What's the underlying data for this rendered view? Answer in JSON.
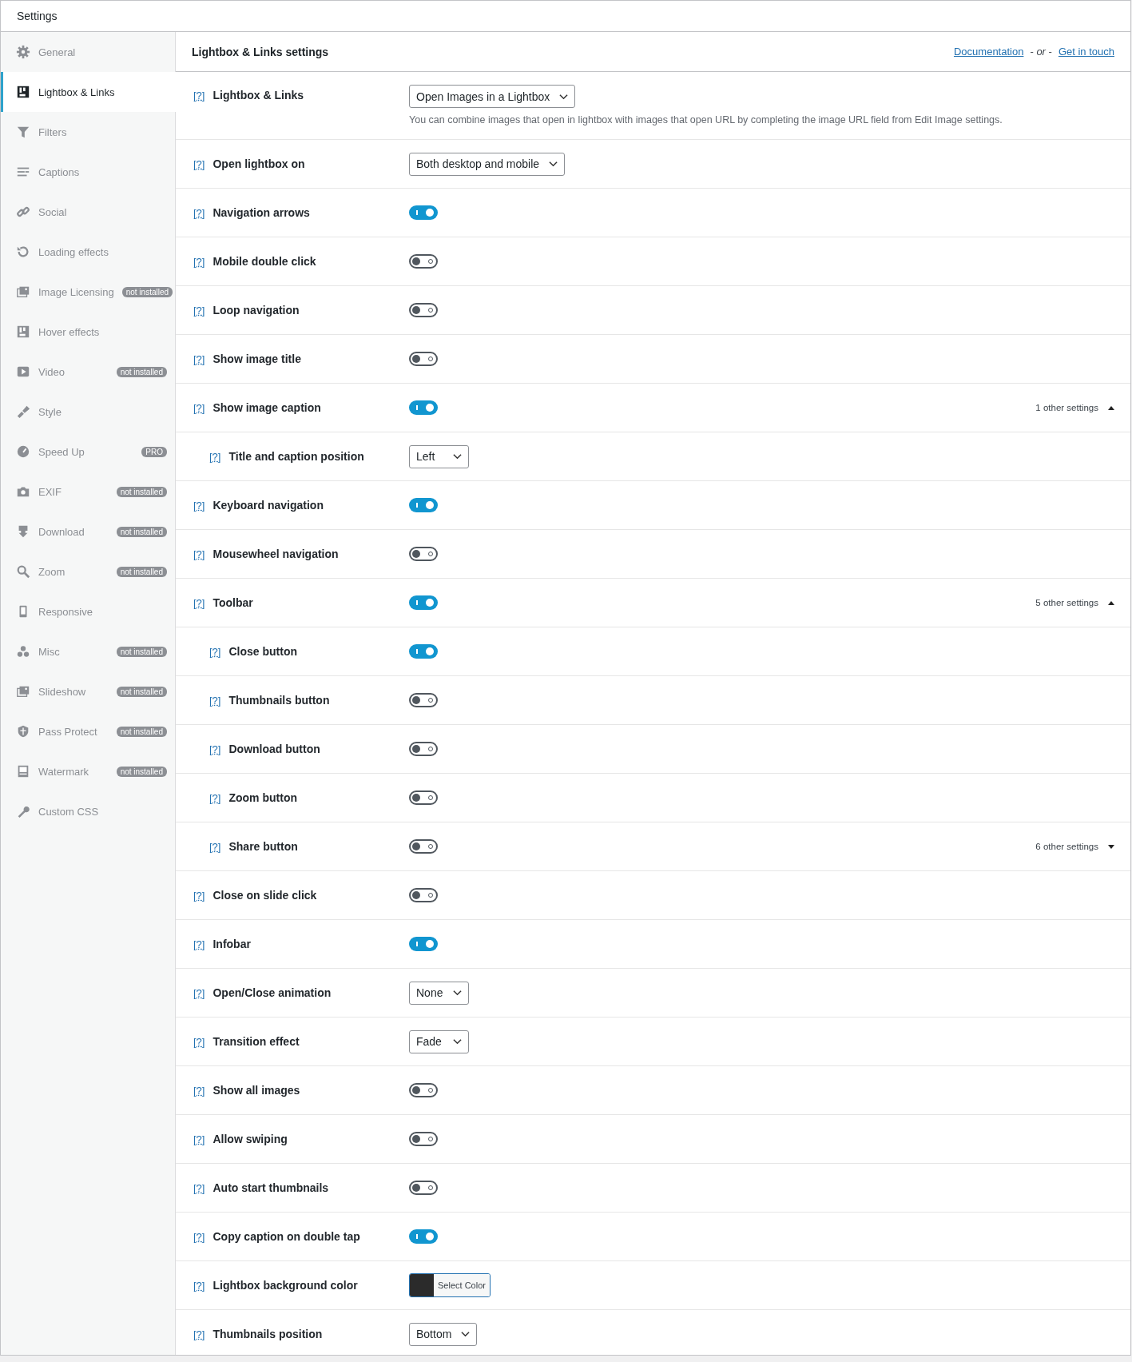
{
  "header": {
    "title": "Settings"
  },
  "sidebar": {
    "items": [
      {
        "label": "General",
        "selected": false
      },
      {
        "label": "Lightbox & Links",
        "selected": true
      },
      {
        "label": "Filters",
        "selected": false
      },
      {
        "label": "Captions",
        "selected": false
      },
      {
        "label": "Social",
        "selected": false
      },
      {
        "label": "Loading effects",
        "selected": false
      },
      {
        "label": "Image Licensing",
        "selected": false,
        "badge": "not installed"
      },
      {
        "label": "Hover effects",
        "selected": false
      },
      {
        "label": "Video",
        "selected": false,
        "badge": "not installed"
      },
      {
        "label": "Style",
        "selected": false
      },
      {
        "label": "Speed Up",
        "selected": false,
        "badge": "PRO"
      },
      {
        "label": "EXIF",
        "selected": false,
        "badge": "not installed"
      },
      {
        "label": "Download",
        "selected": false,
        "badge": "not installed"
      },
      {
        "label": "Zoom",
        "selected": false,
        "badge": "not installed"
      },
      {
        "label": "Responsive",
        "selected": false
      },
      {
        "label": "Misc",
        "selected": false,
        "badge": "not installed"
      },
      {
        "label": "Slideshow",
        "selected": false,
        "badge": "not installed"
      },
      {
        "label": "Pass Protect",
        "selected": false,
        "badge": "not installed"
      },
      {
        "label": "Watermark",
        "selected": false,
        "badge": "not installed"
      },
      {
        "label": "Custom CSS",
        "selected": false
      }
    ]
  },
  "panel": {
    "title": "Lightbox & Links settings",
    "links": {
      "documentation": "Documentation",
      "separator": "- *or* -",
      "contact": "Get in touch"
    },
    "rows": [
      {
        "help": "[?]",
        "label": "Lightbox & Links",
        "kind": "select",
        "value": "Open Images in a Lightbox",
        "note": "You can combine images that open in lightbox with images that open URL by completing the image URL field from Edit Image settings."
      },
      {
        "help": "[?]",
        "label": "Open lightbox on",
        "kind": "select",
        "value": "Both desktop and mobile"
      },
      {
        "help": "[?]",
        "label": "Navigation arrows",
        "kind": "toggle",
        "on": true
      },
      {
        "help": "[?]",
        "label": "Mobile double click",
        "kind": "toggle",
        "on": false
      },
      {
        "help": "[?]",
        "label": "Loop navigation",
        "kind": "toggle",
        "on": false
      },
      {
        "help": "[?]",
        "label": "Show image title",
        "kind": "toggle",
        "on": false
      },
      {
        "help": "[?]",
        "label": "Show image caption",
        "kind": "toggle",
        "on": true,
        "more": {
          "text": "1 other settings",
          "expanded": true
        },
        "children": [
          {
            "help": "[?]",
            "label": "Title and caption position",
            "kind": "select",
            "value": "Left"
          }
        ]
      },
      {
        "help": "[?]",
        "label": "Keyboard navigation",
        "kind": "toggle",
        "on": true
      },
      {
        "help": "[?]",
        "label": "Mousewheel navigation",
        "kind": "toggle",
        "on": false
      },
      {
        "help": "[?]",
        "label": "Toolbar",
        "kind": "toggle",
        "on": true,
        "more": {
          "text": "5 other settings",
          "expanded": true
        },
        "children": [
          {
            "help": "[?]",
            "label": "Close button",
            "kind": "toggle",
            "on": true
          },
          {
            "help": "[?]",
            "label": "Thumbnails button",
            "kind": "toggle",
            "on": false
          },
          {
            "help": "[?]",
            "label": "Download button",
            "kind": "toggle",
            "on": false
          },
          {
            "help": "[?]",
            "label": "Zoom button",
            "kind": "toggle",
            "on": false
          },
          {
            "help": "[?]",
            "label": "Share button",
            "kind": "toggle",
            "on": false,
            "more": {
              "text": "6 other settings",
              "expanded": false
            }
          }
        ]
      },
      {
        "help": "[?]",
        "label": "Close on slide click",
        "kind": "toggle",
        "on": false
      },
      {
        "help": "[?]",
        "label": "Infobar",
        "kind": "toggle",
        "on": true
      },
      {
        "help": "[?]",
        "label": "Open/Close animation",
        "kind": "select",
        "value": "None"
      },
      {
        "help": "[?]",
        "label": "Transition effect",
        "kind": "select",
        "value": "Fade"
      },
      {
        "help": "[?]",
        "label": "Show all images",
        "kind": "toggle",
        "on": false
      },
      {
        "help": "[?]",
        "label": "Allow swiping",
        "kind": "toggle",
        "on": false
      },
      {
        "help": "[?]",
        "label": "Auto start thumbnails",
        "kind": "toggle",
        "on": false
      },
      {
        "help": "[?]",
        "label": "Copy caption on double tap",
        "kind": "toggle",
        "on": true
      },
      {
        "help": "[?]",
        "label": "Lightbox background color",
        "kind": "color",
        "color": "#2b2b2b",
        "button": "Select Color"
      },
      {
        "help": "[?]",
        "label": "Thumbnails position",
        "kind": "select",
        "value": "Bottom"
      }
    ]
  }
}
